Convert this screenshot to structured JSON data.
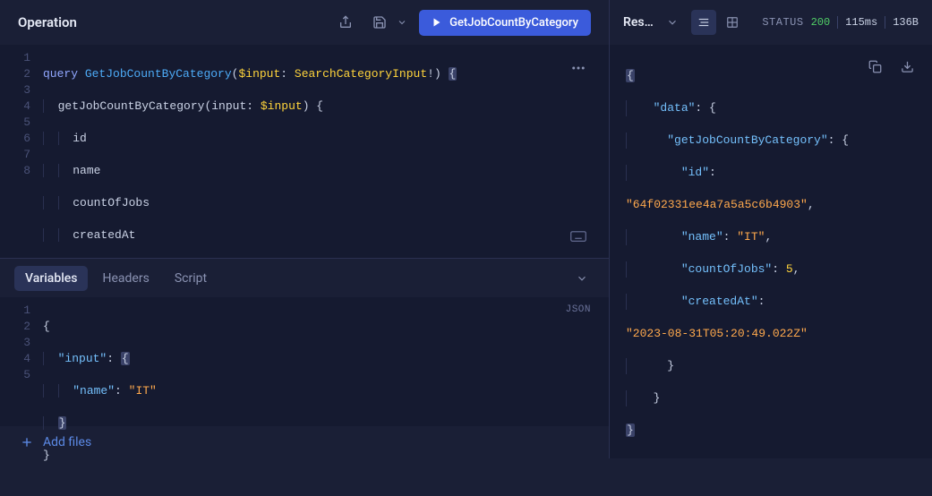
{
  "operation": {
    "title": "Operation",
    "run_button_label": "GetJobCountByCategory",
    "editor": {
      "line_count": 8,
      "tokens": {
        "keyword_query": "query",
        "op_name": "GetJobCountByCategory",
        "var_name": "$input",
        "type_name": "SearchCategoryInput",
        "bang": "!",
        "resolver": "getJobCountByCategory",
        "arg_name": "input",
        "field_id": "id",
        "field_name": "name",
        "field_count": "countOfJobs",
        "field_created": "createdAt"
      }
    }
  },
  "tabs": {
    "variables": "Variables",
    "headers": "Headers",
    "script": "Script",
    "json_badge": "JSON"
  },
  "variables_editor": {
    "line_count": 5,
    "key_input": "\"input\"",
    "key_name": "\"name\"",
    "val_it": "\"IT\""
  },
  "add_files_label": "Add files",
  "response": {
    "title_full": "Response",
    "status_label": "STATUS",
    "status_code": "200",
    "time": "115ms",
    "size": "136B",
    "json": {
      "key_data": "\"data\"",
      "key_resolver": "\"getJobCountByCategory\"",
      "key_id": "\"id\"",
      "val_id": "\"64f02331ee4a7a5a5c6b4903\"",
      "key_name": "\"name\"",
      "val_name": "\"IT\"",
      "key_count": "\"countOfJobs\"",
      "val_count": "5",
      "key_created": "\"createdAt\"",
      "val_created": "\"2023-08-31T05:20:49.022Z\""
    }
  }
}
